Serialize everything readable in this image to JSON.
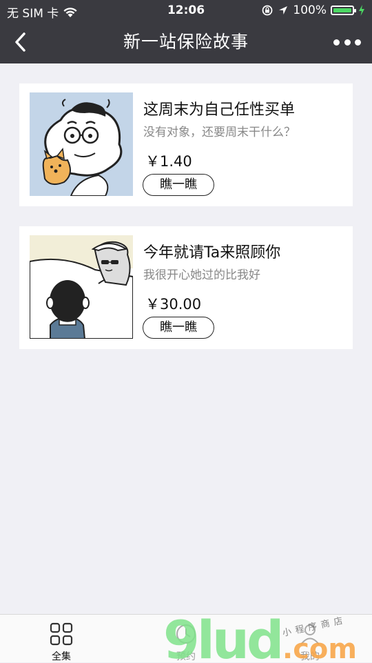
{
  "status_bar": {
    "carrier": "无 SIM 卡",
    "time": "12:06",
    "battery": "100%",
    "battery_level": 1.0
  },
  "nav": {
    "title": "新一站保险故事"
  },
  "stories": [
    {
      "title": "这周末为自己任性买单",
      "subtitle": "没有对象，还要周末干什么？",
      "price": "￥1.40",
      "button": "瞧一瞧"
    },
    {
      "title": "今年就请Ta来照顾你",
      "subtitle": "我很开心她过的比我好",
      "price": "￥30.00",
      "button": "瞧一瞧"
    }
  ],
  "tab_bar": {
    "tabs": [
      {
        "label": "全集",
        "icon": "grid-icon",
        "active": true
      },
      {
        "label": "预约",
        "icon": "clock-icon",
        "active": false
      },
      {
        "label": "我的",
        "icon": "user-icon",
        "active": false
      }
    ]
  },
  "watermark": {
    "brand": "9lud",
    "domain": ".com",
    "tagline": "小程序商店"
  },
  "colors": {
    "nav_bg": "#3a3a40",
    "page_bg": "#f0f0f5",
    "battery_green": "#4cd964"
  }
}
